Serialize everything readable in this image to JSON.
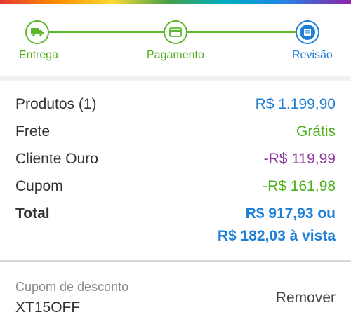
{
  "stepper": {
    "steps": [
      {
        "label": "Entrega",
        "icon": "truck-icon",
        "state": "done"
      },
      {
        "label": "Pagamento",
        "icon": "credit-card-icon",
        "state": "done"
      },
      {
        "label": "Revisão",
        "icon": "list-document-icon",
        "state": "active"
      }
    ]
  },
  "summary": {
    "products_label": "Produtos (1)",
    "products_value": "R$ 1.199,90",
    "shipping_label": "Frete",
    "shipping_value": "Grátis",
    "gold_label": "Cliente Ouro",
    "gold_value": "-R$ 119,99",
    "coupon_label": "Cupom",
    "coupon_value": "-R$ 161,98",
    "total_label": "Total",
    "total_installment": "R$ 917,93 ou",
    "total_cash": "R$ 182,03 à vista"
  },
  "coupon": {
    "caption": "Cupom de desconto",
    "code": "XT15OFF",
    "remove_label": "Remover"
  },
  "colors": {
    "green": "#5cb82a",
    "blue": "#1e7fd6",
    "purple": "#8e3aa0"
  }
}
